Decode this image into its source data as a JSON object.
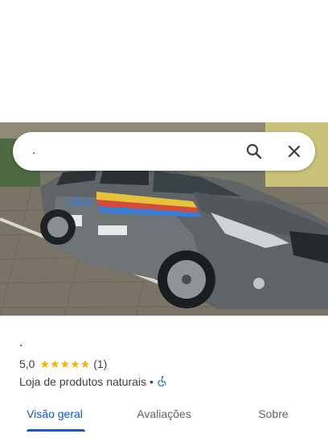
{
  "search": {
    "query": "."
  },
  "place": {
    "name": ".",
    "rating": "5,0",
    "stars": "★★★★★",
    "review_count": "(1)",
    "category": "Loja de produtos naturais",
    "separator": "•"
  },
  "photo": {
    "taxi_label": "TÁXI"
  },
  "tabs": [
    {
      "label": "Visão geral"
    },
    {
      "label": "Avaliações"
    },
    {
      "label": "Sobre"
    }
  ],
  "colors": {
    "accent": "#0b57d0",
    "star": "#f4b400",
    "accessible": "#1a73e8"
  }
}
